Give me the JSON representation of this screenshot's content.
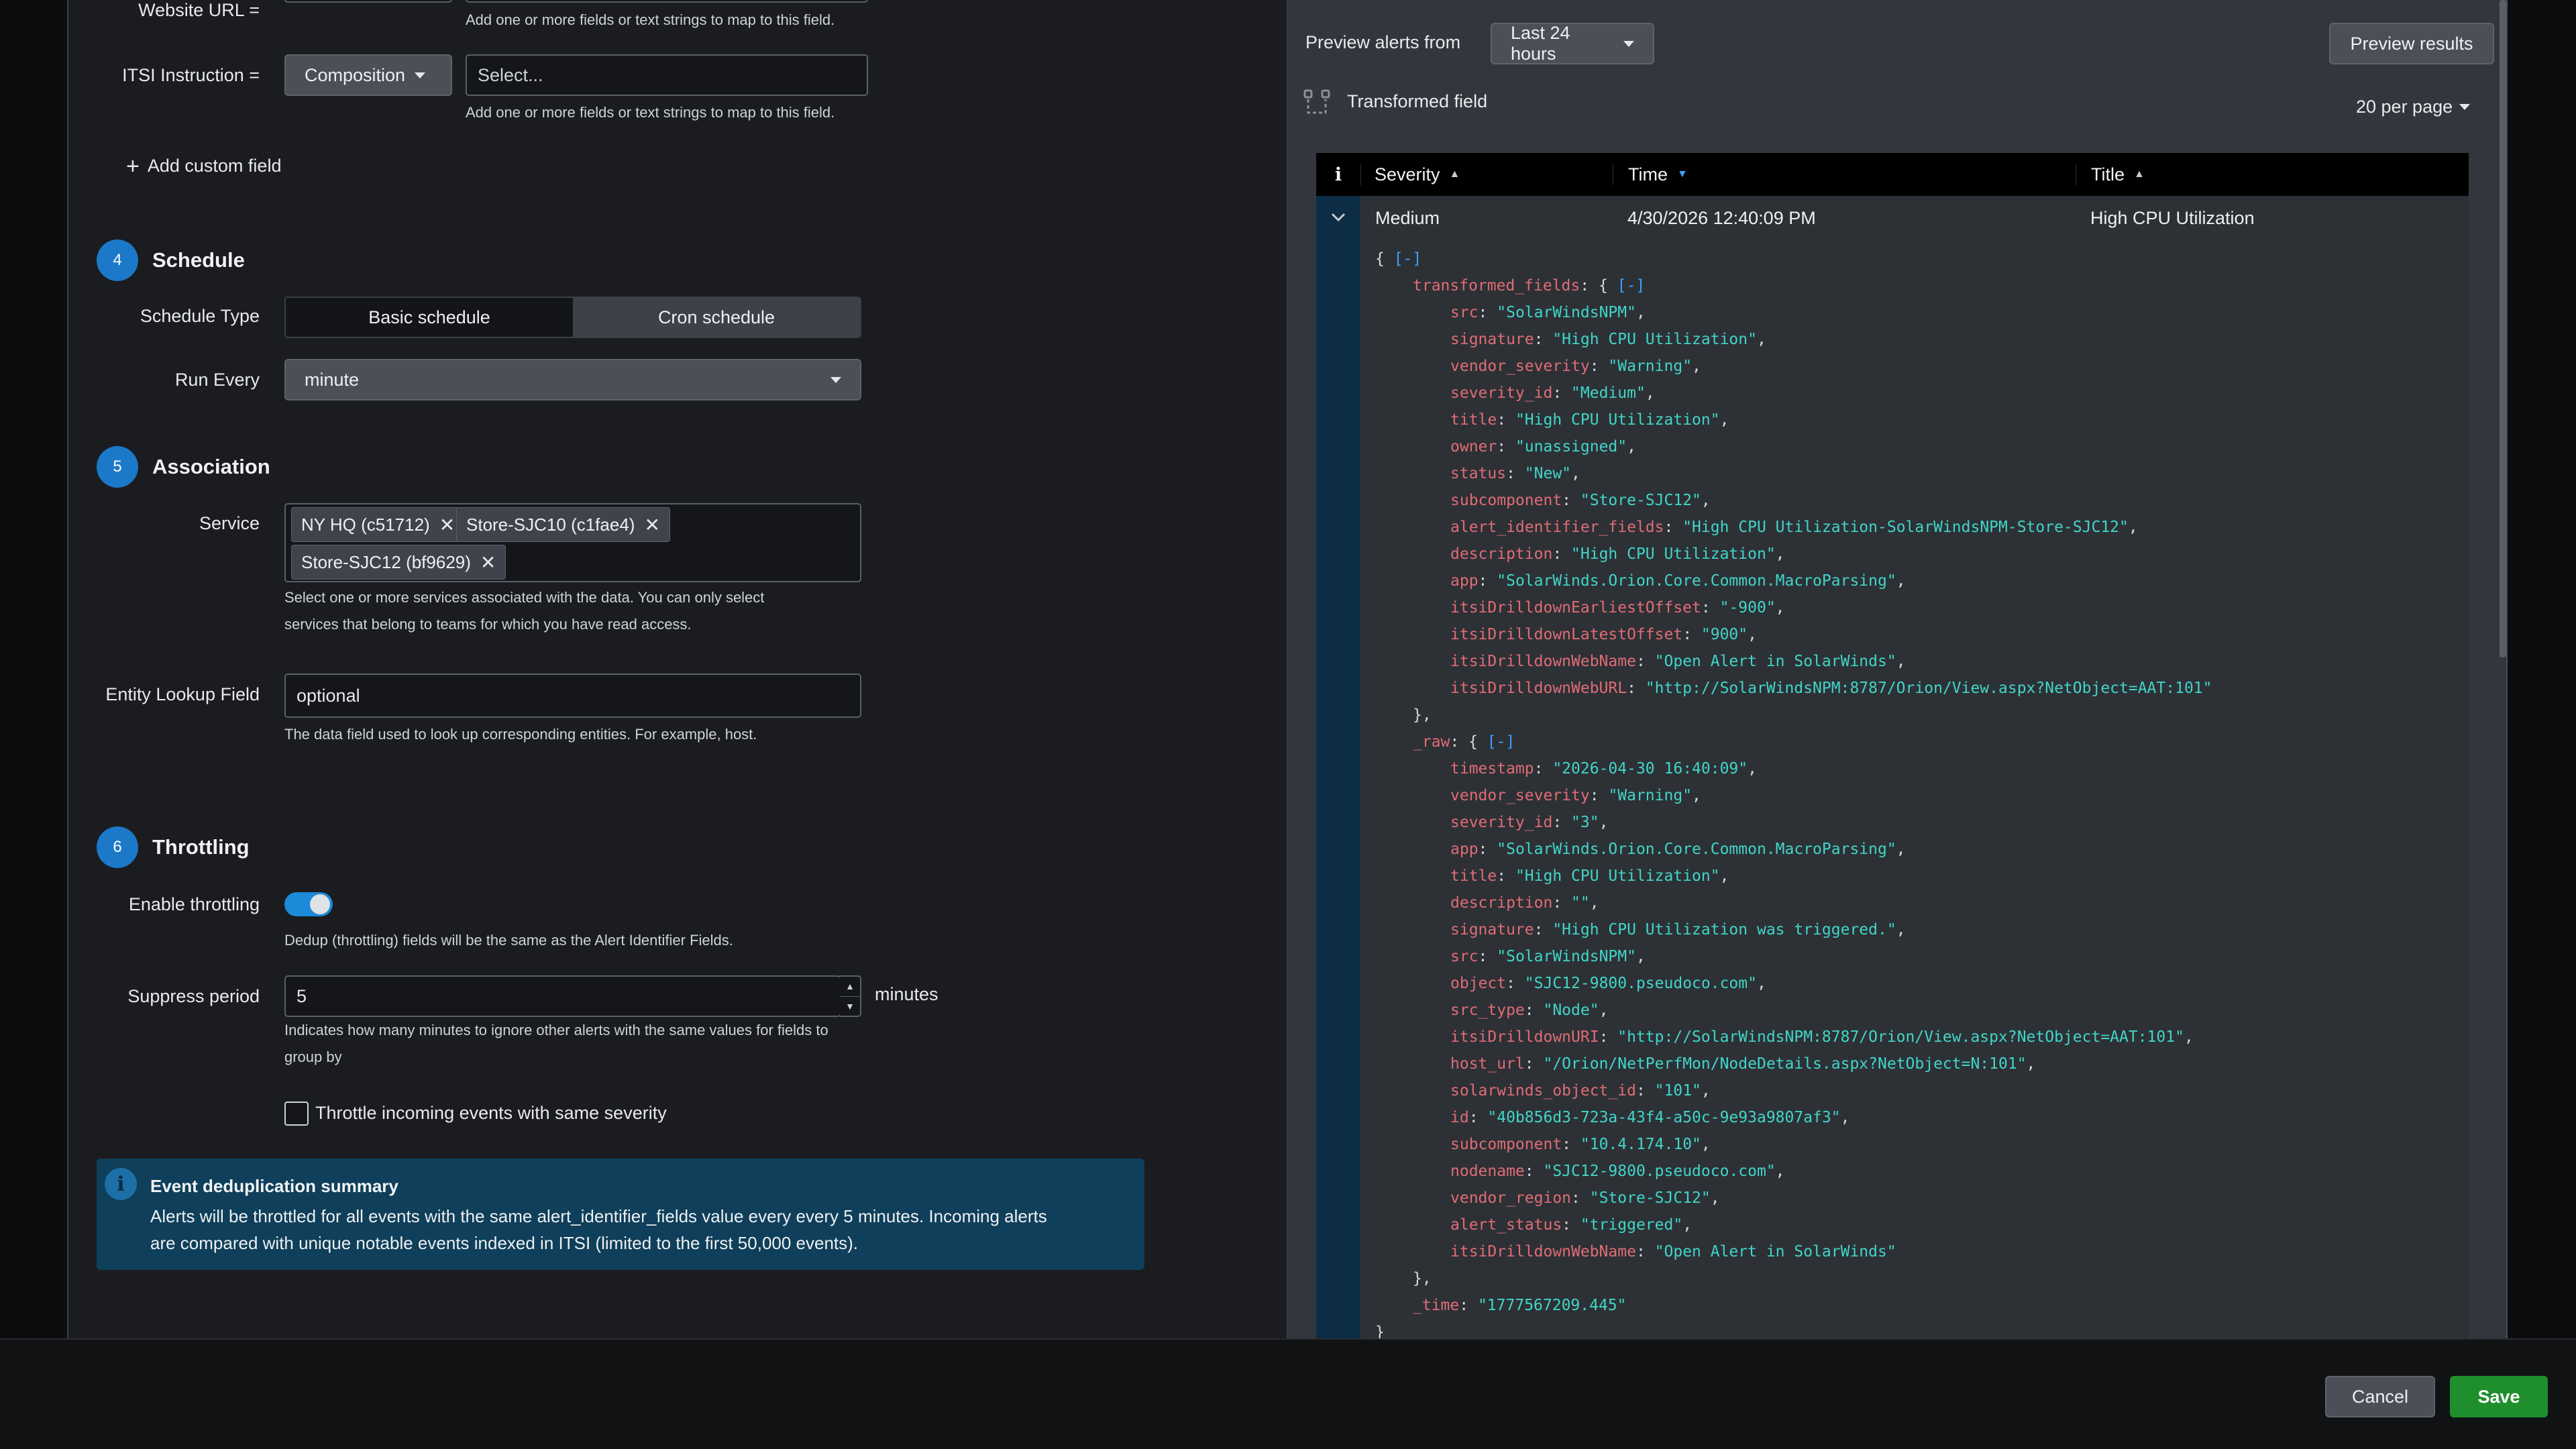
{
  "form": {
    "website_url_label": "Website URL =",
    "field_help": "Add one or more fields or text strings to map to this field.",
    "itsi_label": "ITSI Instruction =",
    "itsi_dropdown": "Composition",
    "itsi_placeholder": "Select...",
    "add_custom_field": "Add custom field",
    "schedule": {
      "number": "4",
      "title": "Schedule",
      "type_label": "Schedule Type",
      "basic": "Basic schedule",
      "cron": "Cron schedule",
      "run_every_label": "Run Every",
      "run_every_value": "minute"
    },
    "association": {
      "number": "5",
      "title": "Association",
      "service_label": "Service",
      "services": [
        "NY HQ (c51712)",
        "Store-SJC10 (c1fae4)",
        "Store-SJC12 (bf9629)"
      ],
      "service_help_1": "Select one or more services associated with the data. You can only select",
      "service_help_2": "services that belong to teams for which you have read access.",
      "entity_label": "Entity Lookup Field",
      "entity_placeholder": "optional",
      "entity_help": "The data field used to look up corresponding entities. For example, host."
    },
    "throttling": {
      "number": "6",
      "title": "Throttling",
      "enable_label": "Enable throttling",
      "enable_help": "Dedup (throttling) fields will be the same as the Alert Identifier Fields.",
      "suppress_label": "Suppress period",
      "suppress_value": "5",
      "suppress_unit": "minutes",
      "suppress_help_1": "Indicates how many minutes to ignore other alerts with the same values for fields to",
      "suppress_help_2": "group by",
      "checkbox_label": "Throttle incoming events with same severity"
    },
    "summary": {
      "title": "Event deduplication summary",
      "line1": "Alerts will be throttled for all events with the same alert_identifier_fields value every every 5 minutes. Incoming alerts",
      "line2": "are compared with unique notable events indexed in ITSI (limited to the first 50,000 events)."
    }
  },
  "preview": {
    "from_label": "Preview alerts from",
    "range": "Last 24 hours",
    "preview_button": "Preview results",
    "transformed_label": "Transformed field",
    "per_page": "20 per page",
    "columns": {
      "info": "i",
      "severity": "Severity",
      "time": "Time",
      "title": "Title"
    },
    "row": {
      "severity": "Medium",
      "time": "4/30/2026 12:40:09 PM",
      "title": "High CPU Utilization"
    },
    "json_lines": [
      {
        "t": "open",
        "text": "{ ",
        "collapse": "[-]"
      },
      {
        "t": "objopen",
        "key": "transformed_fields",
        "collapse": "[-]",
        "indent": 1
      },
      {
        "t": "kv",
        "key": "src",
        "val": "\"SolarWindsNPM\"",
        "indent": 2
      },
      {
        "t": "kv",
        "key": "signature",
        "val": "\"High CPU Utilization\"",
        "indent": 2
      },
      {
        "t": "kv",
        "key": "vendor_severity",
        "val": "\"Warning\"",
        "indent": 2
      },
      {
        "t": "kv",
        "key": "severity_id",
        "val": "\"Medium\"",
        "indent": 2
      },
      {
        "t": "kv",
        "key": "title",
        "val": "\"High CPU Utilization\"",
        "indent": 2
      },
      {
        "t": "kv",
        "key": "owner",
        "val": "\"unassigned\"",
        "indent": 2
      },
      {
        "t": "kv",
        "key": "status",
        "val": "\"New\"",
        "indent": 2
      },
      {
        "t": "kv",
        "key": "subcomponent",
        "val": "\"Store-SJC12\"",
        "indent": 2
      },
      {
        "t": "kv",
        "key": "alert_identifier_fields",
        "val": "\"High CPU Utilization-SolarWindsNPM-Store-SJC12\"",
        "indent": 2
      },
      {
        "t": "kv",
        "key": "description",
        "val": "\"High CPU Utilization\"",
        "indent": 2
      },
      {
        "t": "kv",
        "key": "app",
        "val": "\"SolarWinds.Orion.Core.Common.MacroParsing\"",
        "indent": 2
      },
      {
        "t": "kv",
        "key": "itsiDrilldownEarliestOffset",
        "val": "\"-900\"",
        "indent": 2
      },
      {
        "t": "kv",
        "key": "itsiDrilldownLatestOffset",
        "val": "\"900\"",
        "indent": 2
      },
      {
        "t": "kv",
        "key": "itsiDrilldownWebName",
        "val": "\"Open Alert in SolarWinds\"",
        "indent": 2
      },
      {
        "t": "kvlast",
        "key": "itsiDrilldownWebURL",
        "val": "\"http://SolarWindsNPM:8787/Orion/View.aspx?NetObject=AAT:101\"",
        "indent": 2
      },
      {
        "t": "close",
        "text": "},",
        "indent": 1
      },
      {
        "t": "objopen",
        "key": "_raw",
        "collapse": "[-]",
        "indent": 1
      },
      {
        "t": "kv",
        "key": "timestamp",
        "val": "\"2026-04-30 16:40:09\"",
        "indent": 2
      },
      {
        "t": "kv",
        "key": "vendor_severity",
        "val": "\"Warning\"",
        "indent": 2
      },
      {
        "t": "kv",
        "key": "severity_id",
        "val": "\"3\"",
        "indent": 2
      },
      {
        "t": "kv",
        "key": "app",
        "val": "\"SolarWinds.Orion.Core.Common.MacroParsing\"",
        "indent": 2
      },
      {
        "t": "kv",
        "key": "title",
        "val": "\"High CPU Utilization\"",
        "indent": 2
      },
      {
        "t": "kv",
        "key": "description",
        "val": "\"\"",
        "indent": 2
      },
      {
        "t": "kv",
        "key": "signature",
        "val": "\"High CPU Utilization was triggered.\"",
        "indent": 2
      },
      {
        "t": "kv",
        "key": "src",
        "val": "\"SolarWindsNPM\"",
        "indent": 2
      },
      {
        "t": "kv",
        "key": "object",
        "val": "\"SJC12-9800.pseudoco.com\"",
        "indent": 2
      },
      {
        "t": "kv",
        "key": "src_type",
        "val": "\"Node\"",
        "indent": 2
      },
      {
        "t": "kv",
        "key": "itsiDrilldownURI",
        "val": "\"http://SolarWindsNPM:8787/Orion/View.aspx?NetObject=AAT:101\"",
        "indent": 2
      },
      {
        "t": "kv",
        "key": "host_url",
        "val": "\"/Orion/NetPerfMon/NodeDetails.aspx?NetObject=N:101\"",
        "indent": 2
      },
      {
        "t": "kv",
        "key": "solarwinds_object_id",
        "val": "\"101\"",
        "indent": 2
      },
      {
        "t": "kv",
        "key": "id",
        "val": "\"40b856d3-723a-43f4-a50c-9e93a9807af3\"",
        "indent": 2
      },
      {
        "t": "kv",
        "key": "subcomponent",
        "val": "\"10.4.174.10\"",
        "indent": 2
      },
      {
        "t": "kv",
        "key": "nodename",
        "val": "\"SJC12-9800.pseudoco.com\"",
        "indent": 2
      },
      {
        "t": "kv",
        "key": "vendor_region",
        "val": "\"Store-SJC12\"",
        "indent": 2
      },
      {
        "t": "kv",
        "key": "alert_status",
        "val": "\"triggered\"",
        "indent": 2
      },
      {
        "t": "kvlast",
        "key": "itsiDrilldownWebName",
        "val": "\"Open Alert in SolarWinds\"",
        "indent": 2
      },
      {
        "t": "close",
        "text": "},",
        "indent": 1
      },
      {
        "t": "kvlast",
        "key": "_time",
        "val": "\"1777567209.445\"",
        "indent": 1
      },
      {
        "t": "close",
        "text": "}",
        "indent": 0
      }
    ]
  },
  "footer": {
    "cancel": "Cancel",
    "save": "Save"
  },
  "colors": {
    "accent": "#1c78c8",
    "save": "#1f8f2e",
    "key": "#e06c75",
    "string": "#41d5c8"
  }
}
